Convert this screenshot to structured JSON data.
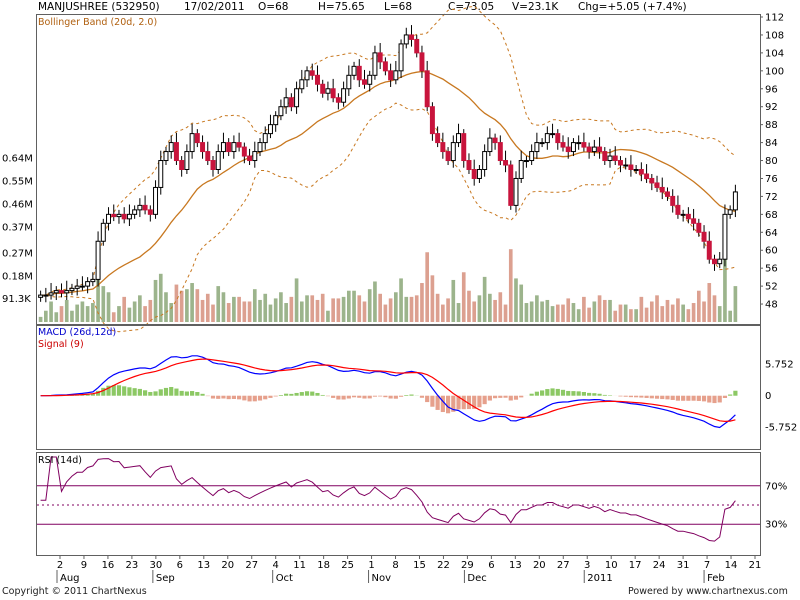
{
  "header": {
    "symbol": "MANJUSHREE (532950)",
    "date": "17/02/2011",
    "open": "O=68",
    "high": "H=75.65",
    "low": "L=68",
    "close": "C=73.05",
    "volume": "V=23.1K",
    "change": "Chg=+5.05 (+7.4%)"
  },
  "labels": {
    "bollinger": "Bollinger Band (20d, 2.0)",
    "macd": "MACD (26d,12d)",
    "signal": "Signal (9)",
    "rsi": "RSI (14d)"
  },
  "footer": {
    "copyright": "Copyright © 2011 ChartNexus",
    "powered": "Powered by www.chartnexus.com"
  },
  "colors": {
    "up": "#ffffff",
    "down": "#c8143c",
    "candle_outline": "#000000",
    "bollinger_mid": "#c87820",
    "bollinger_band": "#c87820",
    "volume_up": "#9cb48c",
    "volume_down": "#dca090",
    "macd": "#0000ff",
    "signal": "#ff0000",
    "hist_up": "#8cc864",
    "hist_down": "#e6a08c",
    "rsi": "#800060",
    "rsi_bounds": "#800060",
    "grid": "#d0d0d0"
  },
  "chart_data": {
    "type": "candlestick",
    "price_axis": {
      "ticks": [
        48,
        52,
        56,
        60,
        64,
        68,
        72,
        76,
        80,
        84,
        88,
        92,
        96,
        100,
        104,
        108,
        112
      ],
      "range": [
        44,
        112
      ]
    },
    "volume_axis": {
      "ticks": [
        "0.64M",
        "0.55M",
        "0.46M",
        "0.37M",
        "0.27M",
        "0.18M",
        "91.3K"
      ],
      "values": [
        640000,
        550000,
        460000,
        370000,
        270000,
        180000,
        91300
      ],
      "max": 780000
    },
    "macd_axis": {
      "ticks": [
        "5.752",
        "0",
        "-5.752"
      ],
      "values": [
        5.752,
        0,
        -5.752
      ],
      "range": [
        -9,
        12
      ]
    },
    "rsi_axis": {
      "ticks": [
        "70%",
        "30%"
      ],
      "values": [
        70,
        30
      ],
      "range": [
        0,
        100
      ]
    },
    "x_labels": {
      "days": [
        "2",
        "9",
        "16",
        "23",
        "30",
        "6",
        "13",
        "20",
        "27",
        "4",
        "11",
        "18",
        "25",
        "1",
        "8",
        "15",
        "22",
        "29",
        "6",
        "13",
        "20",
        "27",
        "3",
        "10",
        "17",
        "24",
        "31",
        "7",
        "14",
        "21"
      ],
      "months": [
        {
          "label": "Aug",
          "day_index": 0
        },
        {
          "label": "Sep",
          "day_index": 4
        },
        {
          "label": "Oct",
          "day_index": 9
        },
        {
          "label": "Nov",
          "day_index": 13
        },
        {
          "label": "Dec",
          "day_index": 17
        },
        {
          "label": "2011",
          "day_index": 22
        },
        {
          "label": "Feb",
          "day_index": 27
        }
      ]
    },
    "close_series": [
      50,
      50,
      50.5,
      51,
      50.5,
      51,
      51.5,
      52,
      52,
      53,
      53.5,
      62,
      66,
      68,
      67.5,
      68,
      67,
      68,
      69,
      70,
      69,
      68,
      74,
      80,
      82,
      84,
      80,
      78,
      82,
      86,
      84,
      82,
      80,
      78,
      82,
      84,
      82,
      84,
      83,
      81,
      80,
      82,
      84,
      86,
      88,
      90,
      92,
      94,
      92,
      96,
      98,
      100,
      99,
      97,
      95,
      96,
      94,
      93,
      96,
      99,
      101,
      98,
      97,
      99,
      104,
      102,
      100,
      98,
      100,
      106,
      108,
      107,
      104,
      100,
      92,
      86,
      84,
      82,
      80,
      84,
      86,
      80,
      78,
      76,
      78,
      82,
      85,
      84,
      80,
      79,
      70,
      76,
      80,
      80,
      82,
      84,
      84,
      86,
      86,
      84,
      83,
      82,
      84,
      84,
      83,
      82,
      83,
      82,
      80,
      81,
      80,
      79,
      79,
      78,
      78,
      77,
      76,
      75,
      74,
      73,
      72,
      70,
      68,
      68,
      67,
      66,
      64,
      62,
      58,
      57,
      58,
      68,
      69,
      73
    ]
  }
}
